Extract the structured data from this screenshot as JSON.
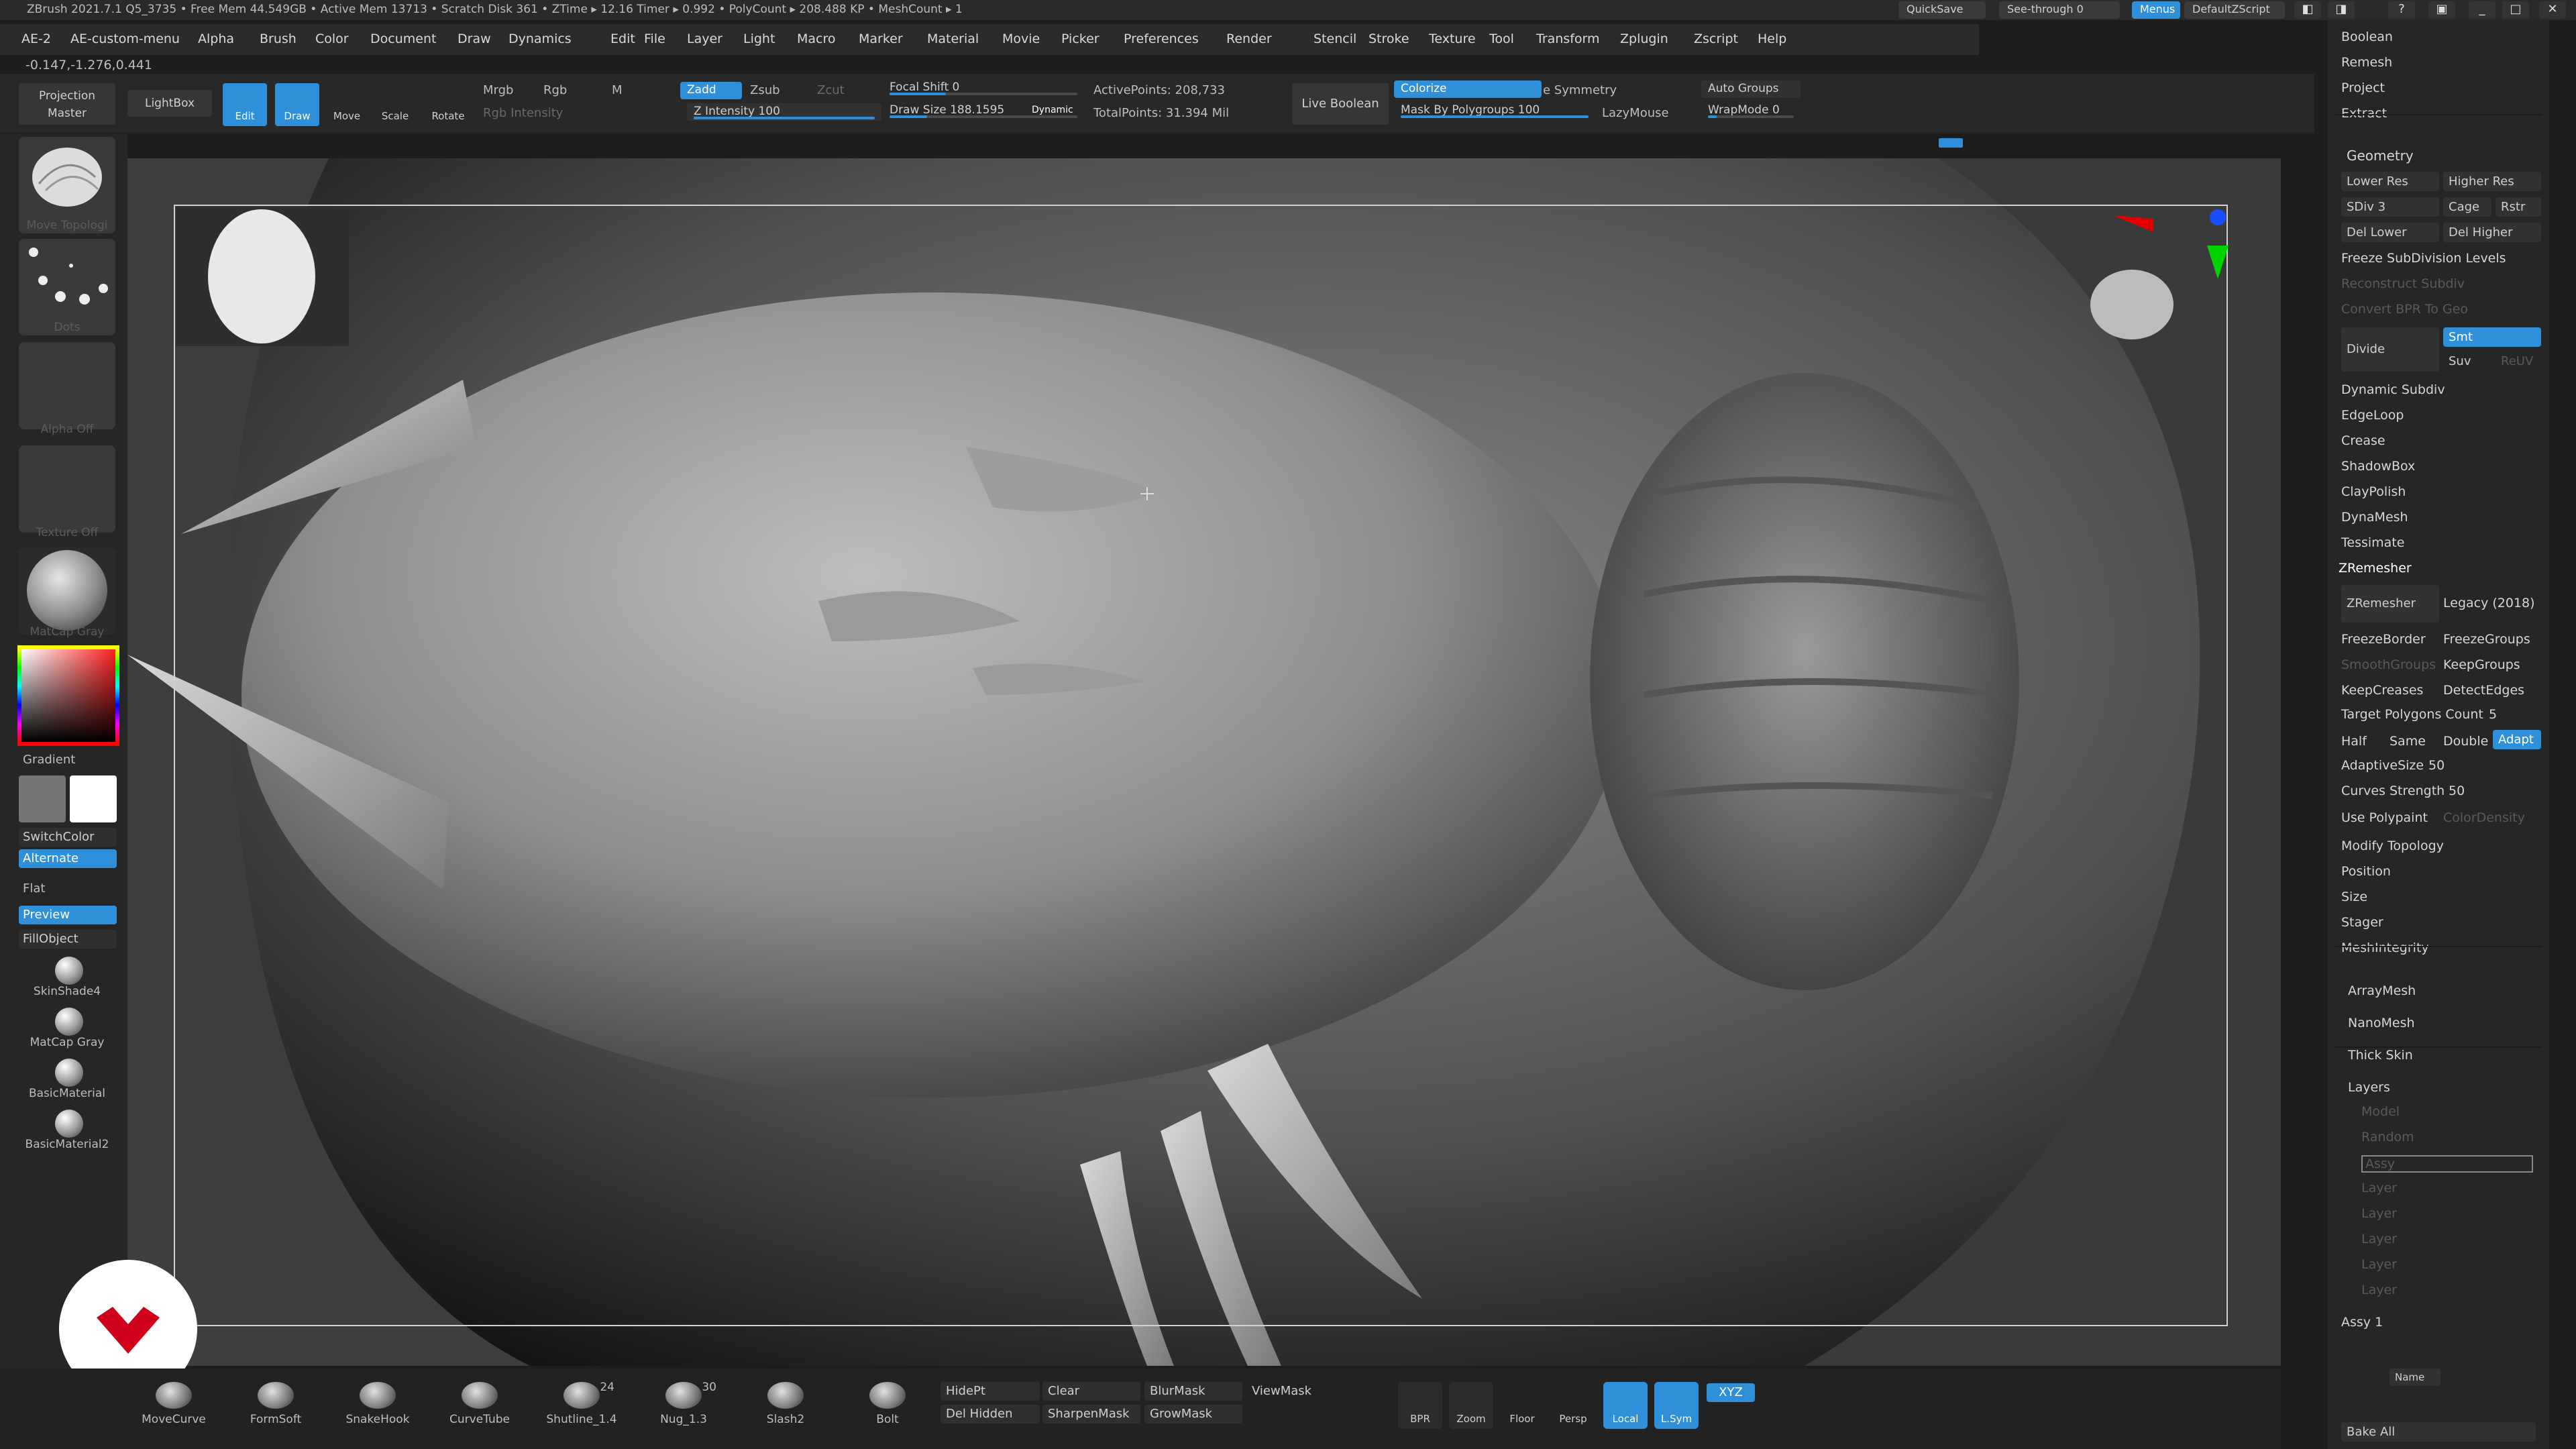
{
  "titlebar": {
    "app_info": "ZBrush 2021.7.1    Q5_3735    • Free Mem 44.549GB • Active Mem 13713 • Scratch Disk 361 •  ZTime ▸ 12.16 Timer ▸ 0.992 • PolyCount ▸ 208.488 KP  • MeshCount ▸ 1",
    "quicksave": "QuickSave",
    "see_through": "See-through  0",
    "menus": "Menus",
    "default_zscript": "DefaultZScript"
  },
  "menubar": [
    "AE-2",
    "AE-custom-menu",
    "Alpha",
    "Brush",
    "Color",
    "Document",
    "Draw",
    "Dynamics",
    "Edit",
    "File",
    "Layer",
    "Light",
    "Macro",
    "Marker",
    "Material",
    "Movie",
    "Picker",
    "Preferences",
    "Render",
    "Stencil",
    "Stroke",
    "Texture",
    "Tool",
    "Transform",
    "Zplugin",
    "Zscript",
    "Help"
  ],
  "coords": "-0.147,-1.276,0.441",
  "topshelf": {
    "projection_master": "Projection Master",
    "lightbox": "LightBox",
    "edit": "Edit",
    "draw": "Draw",
    "move": "Move",
    "scale": "Scale",
    "rotate": "Rotate",
    "mrgb": "Mrgb",
    "rgb": "Rgb",
    "m": "M",
    "rgb_intensity": "Rgb Intensity",
    "zadd": "Zadd",
    "zsub": "Zsub",
    "zcut": "Zcut",
    "z_intensity_label": "Z Intensity",
    "z_intensity_value": "100",
    "focal_shift_label": "Focal Shift",
    "focal_shift_value": "0",
    "draw_size_label": "Draw Size",
    "draw_size_value": "188.1595",
    "dynamic": "Dynamic",
    "active_points": "ActivePoints: 208,733",
    "total_points": "TotalPoints: 31.394 Mil",
    "live_boolean": "Live Boolean",
    "colorize": "Colorize",
    "symmetry": "e Symmetry",
    "mask_by_polygroups": "Mask By Polygroups 100",
    "lazymouse": "LazyMouse",
    "auto_groups": "Auto Groups",
    "wrapmode": "WrapMode 0"
  },
  "leftbar": {
    "move_topologic": "Move Topologi",
    "dots": "Dots",
    "alpha_off": "Alpha Off",
    "texture_off": "Texture Off",
    "matcap_gray": "MatCap Gray",
    "gradient": "Gradient",
    "switchcolor": "SwitchColor",
    "alternate": "Alternate",
    "flat": "Flat",
    "preview": "Preview",
    "fillobject": "FillObject",
    "skinshade4": "SkinShade4",
    "matcap_gray2": "MatCap Gray",
    "basicmaterial": "BasicMaterial",
    "basicmaterial2": "BasicMaterial2"
  },
  "rightpanel": {
    "top_items": [
      "Boolean",
      "Remesh",
      "Project",
      "Extract"
    ],
    "geometry": "Geometry",
    "lower_res": "Lower Res",
    "higher_res": "Higher Res",
    "sdiv": "SDiv 3",
    "cage": "Cage",
    "rstr": "Rstr",
    "del_lower": "Del Lower",
    "del_higher": "Del Higher",
    "freeze_subdiv": "Freeze SubDivision Levels",
    "reconstruct_subdiv": "Reconstruct Subdiv",
    "convert_bpr": "Convert BPR To Geo",
    "divide": "Divide",
    "smt": "Smt",
    "suv": "Suv",
    "reuv": "ReUV",
    "mid_items": [
      "Dynamic Subdiv",
      "EdgeLoop",
      "Crease",
      "ShadowBox",
      "ClayPolish",
      "DynaMesh",
      "Tessimate"
    ],
    "zremesher_header": "ZRemesher",
    "zremesher_btn": "ZRemesher",
    "legacy": "Legacy (2018)",
    "freezeborder": "FreezeBorder",
    "freezegroups": "FreezeGroups",
    "smoothgroups": "SmoothGroups",
    "keepgroups": "KeepGroups",
    "keepcreases": "KeepCreases",
    "detectedges": "DetectEdges",
    "target_polygons": "Target Polygons Count",
    "target_value": "5",
    "half": "Half",
    "same": "Same",
    "double": "Double",
    "adapt": "Adapt",
    "adaptive_size": "AdaptiveSize",
    "adaptive_value": "50",
    "curves_strength": "Curves Strength",
    "curves_value": "50",
    "use_polypaint": "Use Polypaint",
    "colordensity": "ColorDensity",
    "lower_items": [
      "Modify Topology",
      "Position",
      "Size",
      "Stager",
      "MeshIntegrity"
    ],
    "arraymesh": "ArrayMesh",
    "nanomesh": "NanoMesh",
    "thick_skin": "Thick Skin",
    "layers": "Layers",
    "layer_items": [
      "Model",
      "Random",
      "Assy",
      "Layer",
      "Layer",
      "Layer",
      "Layer",
      "Layer"
    ],
    "assy": "Assy 1",
    "name": "Name",
    "bake_all": "Bake All"
  },
  "bottombar": {
    "brushes": [
      {
        "label": "MoveCurve",
        "count": ""
      },
      {
        "label": "FormSoft",
        "count": ""
      },
      {
        "label": "SnakeHook",
        "count": ""
      },
      {
        "label": "CurveTube",
        "count": ""
      },
      {
        "label": "Shutline_1.4",
        "count": "24"
      },
      {
        "label": "Nug_1.3",
        "count": "30"
      },
      {
        "label": "Slash2",
        "count": ""
      },
      {
        "label": "Bolt",
        "count": ""
      }
    ],
    "hidept": "HidePt",
    "clear": "Clear",
    "blurmask": "BlurMask",
    "viewmask": "ViewMask",
    "del_hidden": "Del Hidden",
    "sharpenmask": "SharpenMask",
    "growmask": "GrowMask",
    "bpr": "BPR",
    "zoom": "Zoom",
    "floor": "Floor",
    "persp": "Persp",
    "local": "Local",
    "lsym": "L.Sym",
    "xyz": "XYZ"
  },
  "colors": {
    "accent": "#2f8fd8",
    "background": "#1d1d1d",
    "logo_red": "#d0021b"
  }
}
